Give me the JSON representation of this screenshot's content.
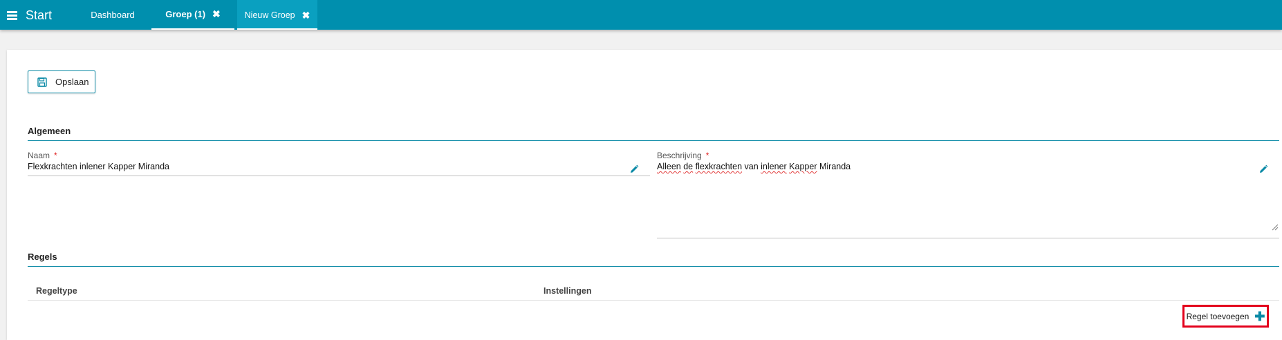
{
  "topbar": {
    "start_label": "Start",
    "tabs": [
      {
        "label": "Dashboard"
      },
      {
        "label": "Groep (1)",
        "close": "✖"
      },
      {
        "label": "Nieuw Groep",
        "close": "✖"
      }
    ],
    "color": "#008fae"
  },
  "toolbar": {
    "save_label": "Opslaan"
  },
  "sections": {
    "general": {
      "title": "Algemeen",
      "name_label": "Naam",
      "name_required": "*",
      "name_value": "Flexkrachten inlener Kapper Miranda",
      "description_label": "Beschrijving",
      "description_required": "*",
      "description_words": [
        "Alleen",
        "de",
        "flexkrachten",
        "van",
        "inlener",
        "Kapper",
        "Miranda"
      ]
    },
    "rules": {
      "title": "Regels",
      "columns": [
        "Regeltype",
        "Instellingen"
      ],
      "add_label": "Regel toevoegen"
    }
  },
  "icons": {
    "menu": "hamburger-icon",
    "save": "floppy-disk-icon",
    "edit": "pencil-icon",
    "add": "plus-icon",
    "close": "close-icon"
  },
  "colors": {
    "accent": "#0b8aa6",
    "required": "#e02020",
    "highlight": "#e3001b"
  }
}
